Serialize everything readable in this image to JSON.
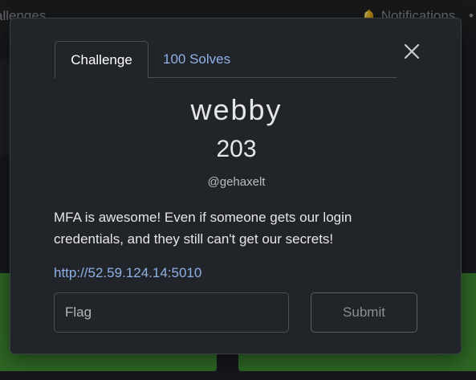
{
  "background": {
    "nav_left_text": "allenges",
    "notifications_label": "Notifications",
    "nav_right_trailing": "•",
    "colors": {
      "page": "#1e2124",
      "green_button": "#3f8e33"
    }
  },
  "modal": {
    "tabs": [
      {
        "label": "Challenge",
        "active": true
      },
      {
        "label": "100 Solves",
        "active": false
      }
    ],
    "challenge": {
      "name": "webby",
      "points": "203",
      "author": "@gehaxelt",
      "description": "MFA is awesome! Even if someone gets our login credentials, and they still can't get our secrets!",
      "link": "http://52.59.124.14:5010"
    },
    "flag_input": {
      "value": "",
      "placeholder": "Flag"
    },
    "submit_label": "Submit",
    "close_icon": "close-icon",
    "colors": {
      "background": "#212529",
      "link": "#8fb1e6",
      "border": "#4a4f55"
    }
  }
}
